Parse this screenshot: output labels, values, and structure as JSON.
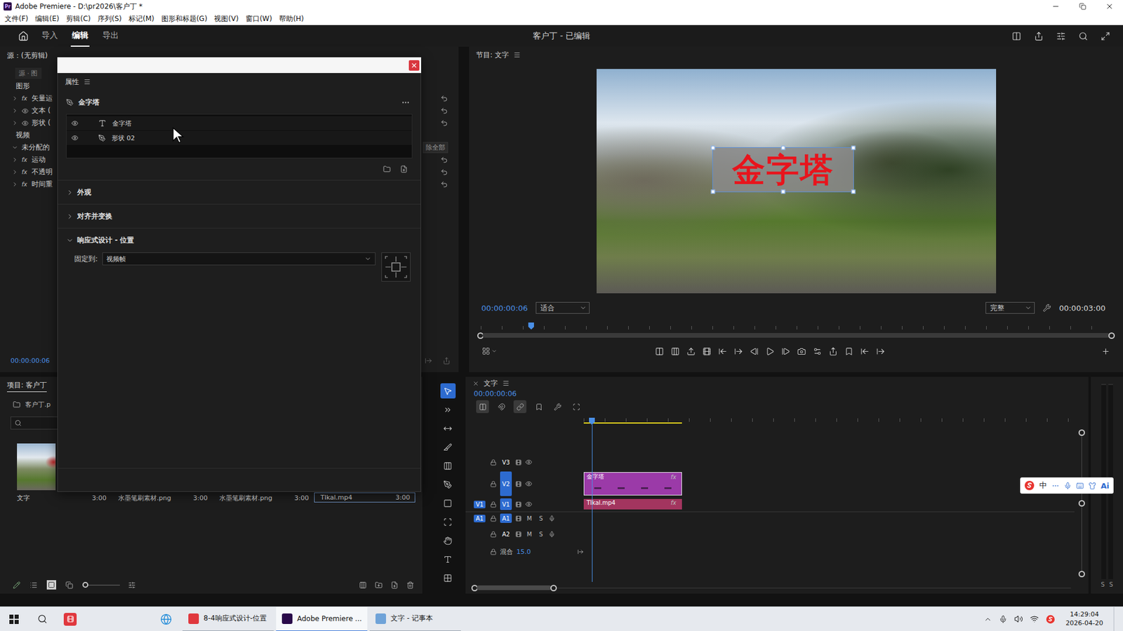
{
  "window": {
    "logo": "Pr",
    "title": "Adobe Premiere - D:\\pr2026\\客户丁 *"
  },
  "menu": [
    "文件(F)",
    "编辑(E)",
    "剪辑(C)",
    "序列(S)",
    "标记(M)",
    "图形和标题(G)",
    "视图(V)",
    "窗口(W)",
    "帮助(H)"
  ],
  "header": {
    "tabs": [
      {
        "label": "导入",
        "selected": false
      },
      {
        "label": "编辑",
        "selected": true
      },
      {
        "label": "导出",
        "selected": false
      }
    ],
    "title": "客户丁 - 已编辑"
  },
  "badges": {
    "fx": "fx"
  },
  "source_panel": {
    "tab": "源：(无剪辑)",
    "subheader": "源 · 图",
    "rows": [
      {
        "label": "图形",
        "kind": "section"
      },
      {
        "label": "矢量运",
        "kind": "effect",
        "fx": true,
        "eye": false,
        "expanded": false,
        "reset": true
      },
      {
        "label": "文本 (",
        "kind": "effect",
        "fx": false,
        "eye": true,
        "expanded": false,
        "reset": true
      },
      {
        "label": "形状 (",
        "kind": "effect",
        "fx": false,
        "eye": true,
        "expanded": false,
        "reset": true
      },
      {
        "label": "视频",
        "kind": "section"
      },
      {
        "label": "未分配的",
        "kind": "group",
        "expanded": true
      },
      {
        "label": "运动",
        "kind": "effect",
        "fx": true,
        "eye": false,
        "expanded": false,
        "reset": true
      },
      {
        "label": "不透明",
        "kind": "effect",
        "fx": true,
        "eye": false,
        "expanded": false,
        "reset": true
      },
      {
        "label": "时间重",
        "kind": "effect",
        "fx": true,
        "eye": false,
        "expanded": false,
        "reset": true
      }
    ],
    "remove_all": "除全部",
    "time": "00:00:00:06"
  },
  "properties": {
    "tab": "属性",
    "title": "金字塔",
    "layers": [
      {
        "name": "金字塔",
        "kind": "text",
        "visible": true
      },
      {
        "name": "形状 02",
        "kind": "shape",
        "visible": true
      }
    ],
    "sections": [
      {
        "label": "外观",
        "expanded": false
      },
      {
        "label": "对齐并变换",
        "expanded": false
      },
      {
        "label": "响应式设计 - 位置",
        "expanded": true
      }
    ],
    "pin": {
      "label": "固定到:",
      "value": "视频帧"
    }
  },
  "program": {
    "tab": "节目: 文字",
    "timecode": "00:00:00:06",
    "zoom": "适合",
    "quality": "完整",
    "duration": "00:00:03:00",
    "playhead": 0.08,
    "graphic": {
      "text": "金字塔",
      "selected": true
    }
  },
  "project": {
    "tab": "项目: 客户丁",
    "file": "客户丁.p",
    "zoom_level": 0,
    "items": [
      {
        "name": "文字",
        "duration": "3:00",
        "selected": false
      },
      {
        "name": "水墨笔刷素材.png",
        "duration": "3:00",
        "selected": false
      },
      {
        "name": "水墨笔刷素材.png",
        "duration": "3:00",
        "selected": false
      },
      {
        "name": "TIkal.mp4",
        "duration": "3:00",
        "selected": true
      }
    ]
  },
  "tools": [
    {
      "kind": "select",
      "selected": true
    },
    {
      "kind": "track-select",
      "selected": false
    },
    {
      "kind": "ripple",
      "selected": false
    },
    {
      "kind": "razor",
      "selected": false
    },
    {
      "kind": "slip",
      "selected": false
    },
    {
      "kind": "pen",
      "selected": false
    },
    {
      "kind": "rectangle",
      "selected": false
    },
    {
      "kind": "remix",
      "selected": false
    },
    {
      "kind": "hand",
      "selected": false
    },
    {
      "kind": "type",
      "selected": false
    },
    {
      "kind": "vertical-type",
      "selected": false
    }
  ],
  "timeline": {
    "tab": "文字",
    "timecode": "00:00:00:06",
    "view_seconds": 15,
    "playhead_seconds": 0.25,
    "work_area": {
      "start": 0,
      "end": 3
    },
    "tracks": [
      {
        "name": "V3",
        "kind": "video",
        "selected": false,
        "visible": true
      },
      {
        "name": "V2",
        "kind": "video",
        "selected": true,
        "visible": true
      },
      {
        "name": "V1",
        "kind": "video",
        "selected": true,
        "visible": true,
        "source": "V1",
        "source_selected": true
      },
      {
        "name": "A1",
        "kind": "audio",
        "selected": true,
        "source": "A1",
        "source_selected": true,
        "buttons": [
          "M",
          "S"
        ]
      },
      {
        "name": "A2",
        "kind": "audio",
        "selected": false,
        "buttons": [
          "M",
          "S"
        ]
      }
    ],
    "mix": {
      "label": "混合",
      "value": "15.0"
    },
    "clips": [
      {
        "label": "金字塔",
        "track": "V2",
        "kind": "graphic",
        "start": 0,
        "end": 3,
        "color": "#9b3aa8",
        "fx": true
      },
      {
        "label": "TIkal.mp4",
        "track": "V1",
        "kind": "video",
        "start": 0,
        "end": 3,
        "color": "#a3355f",
        "fx": true
      }
    ]
  },
  "meter": {
    "labels": [
      "S",
      "S"
    ]
  },
  "taskbar": {
    "apps": [
      {
        "label": "8-4响应式设计-位置",
        "active": false
      },
      {
        "label": "Adobe Premiere ...",
        "active": true
      },
      {
        "label": "文字 - 记事本",
        "active": false
      }
    ],
    "time": "14:29:04",
    "date": "2026-04-20"
  },
  "ime": {
    "labels": [
      "中",
      "Ai"
    ]
  }
}
